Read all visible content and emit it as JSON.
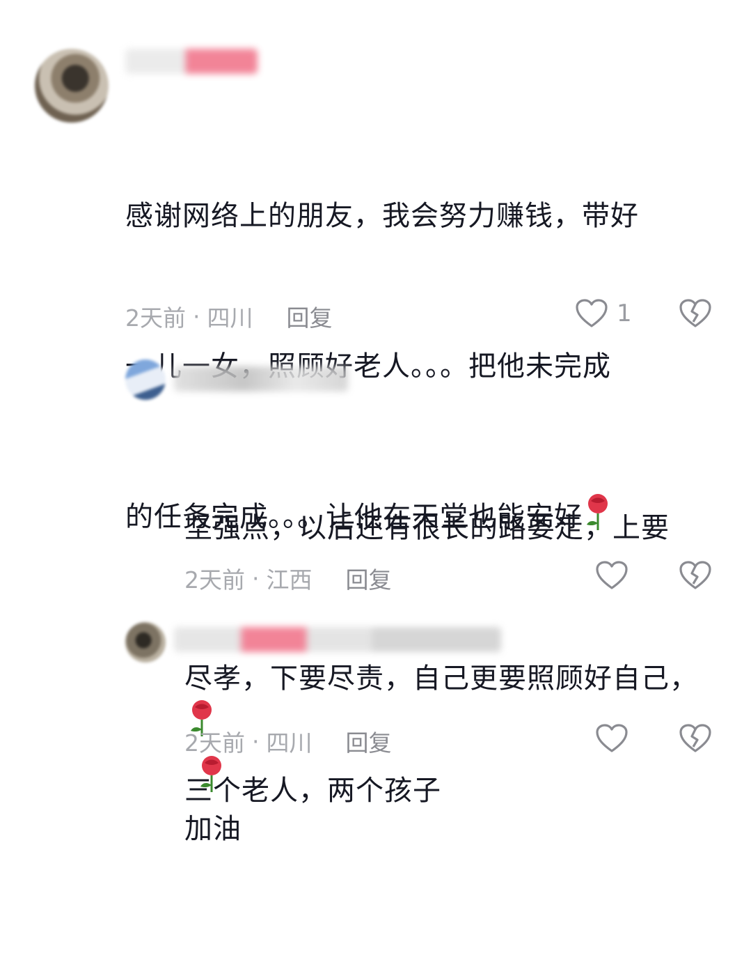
{
  "comments": [
    {
      "text_lines": [
        "感谢网络上的朋友，我会努力赚钱，带好",
        "一儿一女，照顾好老人。。。把他未完成",
        "的任务完成。。。让他在天堂也能安好"
      ],
      "time": "2天前",
      "location": "四川",
      "reply_label": "回复",
      "like_count": "1"
    },
    {
      "text_lines": [
        "坚强点，以后还有很长的路要走，上要",
        "尽孝，下要尽责，自己更要照顾好自己，",
        "加油"
      ],
      "time": "2天前",
      "location": "江西",
      "reply_label": "回复"
    },
    {
      "text_lines": [
        "三个老人，两个孩子"
      ],
      "time": "2天前",
      "location": "四川",
      "reply_label": "回复"
    }
  ],
  "separator": "·",
  "icons": {
    "like": "heart-outline-icon",
    "dislike": "broken-heart-icon",
    "emoji": "rose-emoji"
  },
  "colors": {
    "text": "#161823",
    "meta": "#a7a9ae",
    "icon": "#8a8b91",
    "rose": "#e0364a"
  }
}
